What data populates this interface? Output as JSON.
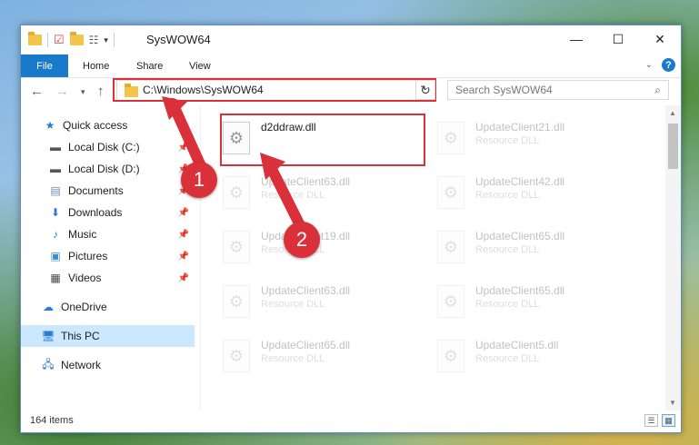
{
  "window": {
    "title": "SysWOW64",
    "controls": {
      "minimize": "—",
      "maximize": "☐",
      "close": "✕"
    }
  },
  "ribbon": {
    "tabs": [
      "File",
      "Home",
      "Share",
      "View"
    ],
    "help": "?"
  },
  "navigation": {
    "address": "C:\\Windows\\SysWOW64",
    "search_placeholder": "Search SysWOW64"
  },
  "sidebar": {
    "items": [
      {
        "label": "Quick access",
        "icon": "star-icon",
        "pinned": false
      },
      {
        "label": "Local Disk (C:)",
        "icon": "drive-icon",
        "pinned": true
      },
      {
        "label": "Local Disk (D:)",
        "icon": "drive-icon",
        "pinned": true
      },
      {
        "label": "Documents",
        "icon": "documents-icon",
        "pinned": true
      },
      {
        "label": "Downloads",
        "icon": "download-icon",
        "pinned": true
      },
      {
        "label": "Music",
        "icon": "music-icon",
        "pinned": true
      },
      {
        "label": "Pictures",
        "icon": "pictures-icon",
        "pinned": true
      },
      {
        "label": "Videos",
        "icon": "videos-icon",
        "pinned": true
      },
      {
        "label": "OneDrive",
        "icon": "cloud-icon",
        "pinned": false
      },
      {
        "label": "This PC",
        "icon": "computer-icon",
        "pinned": false,
        "selected": true
      },
      {
        "label": "Network",
        "icon": "network-icon",
        "pinned": false
      }
    ]
  },
  "files": [
    {
      "name": "d2ddraw.dll",
      "type": ""
    },
    {
      "name": "UpdateClient21.dll",
      "type": "Resource DLL"
    },
    {
      "name": "UpdateClient63.dll",
      "type": "Resource DLL"
    },
    {
      "name": "UpdateClient42.dll",
      "type": "Resource DLL"
    },
    {
      "name": "UpdateClient19.dll",
      "type": "Resource DLL"
    },
    {
      "name": "UpdateClient65.dll",
      "type": "Resource DLL"
    },
    {
      "name": "UpdateClient63.dll",
      "type": "Resource DLL"
    },
    {
      "name": "UpdateClient65.dll",
      "type": "Resource DLL"
    },
    {
      "name": "UpdateClient65.dll",
      "type": "Resource DLL"
    },
    {
      "name": "UpdateClient5.dll",
      "type": "Resource DLL"
    }
  ],
  "status": {
    "item_count": "164 items"
  },
  "annotations": [
    {
      "label": "1"
    },
    {
      "label": "2"
    }
  ],
  "colors": {
    "accent": "#1979ca",
    "highlight": "#d9303a",
    "selected": "#cce8ff"
  }
}
